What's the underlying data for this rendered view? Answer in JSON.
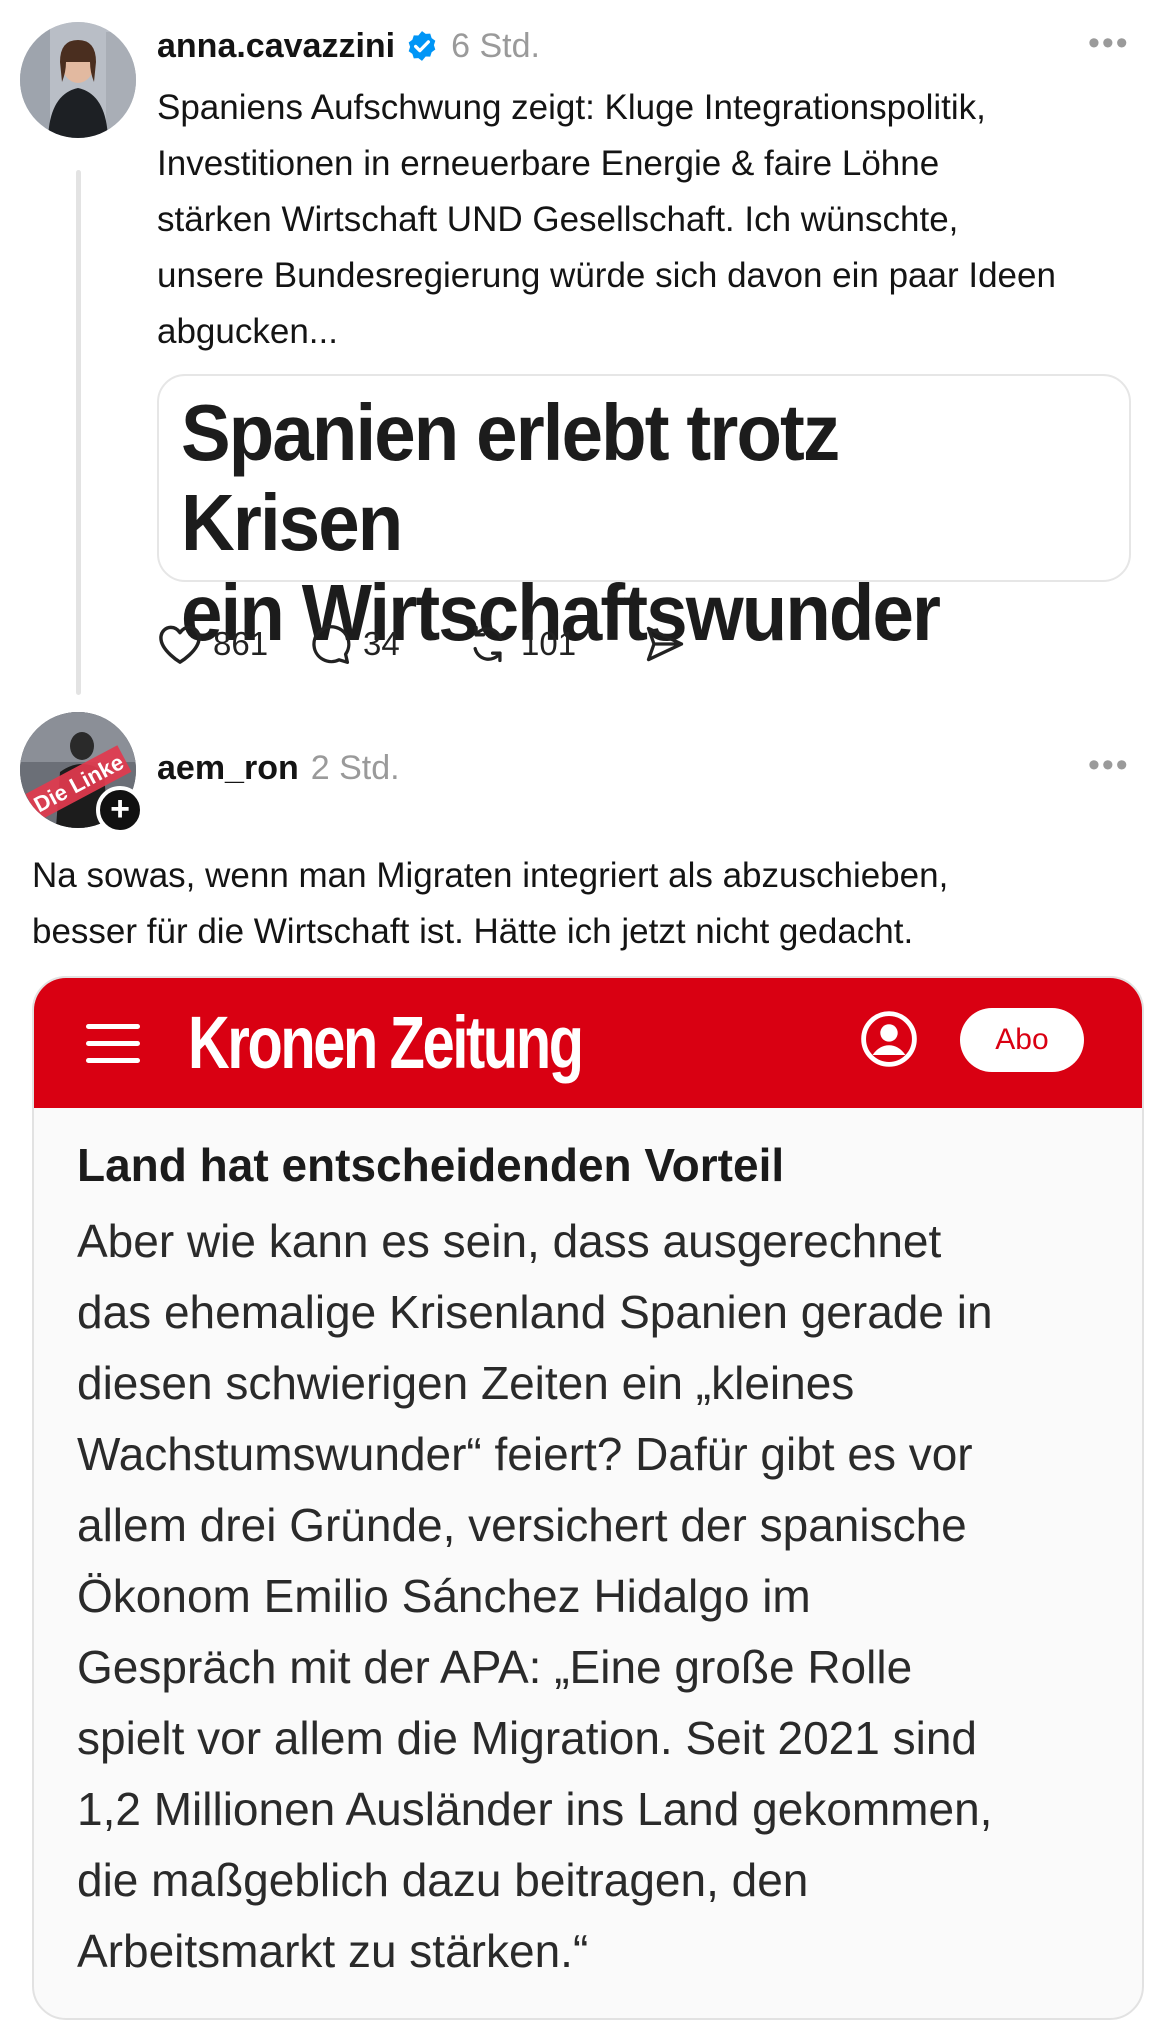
{
  "post1": {
    "username": "anna.cavazzini",
    "time": "6 Std.",
    "more": "•••",
    "text_lines": [
      "Spaniens Aufschwung zeigt: Kluge Integrationspolitik,",
      "Investitionen in erneuerbare Energie & faire Löhne",
      "stärken Wirtschaft UND Gesellschaft. Ich wünschte,",
      "unsere Bundesregierung würde sich davon ein paar Ideen",
      "abgucken..."
    ],
    "quote_lines": [
      "Spanien erlebt trotz Krisen",
      "ein Wirtschaftswunder"
    ],
    "actions": {
      "likes": "861",
      "comments": "34",
      "reposts": "101"
    }
  },
  "post2": {
    "username": "aem_ron",
    "time": "2 Std.",
    "more": "•••",
    "avatar_text": "Die Linke",
    "text_lines": [
      "Na sowas, wenn man Migraten integriert als abzuschieben,",
      "besser für die Wirtschaft ist. Hätte ich jetzt nicht gedacht."
    ]
  },
  "kronen": {
    "logo": "Kronen Zeitung",
    "abo": "Abo",
    "subheading": "Land hat entscheidenden Vorteil",
    "body_lines": [
      "Aber wie kann es sein, dass ausgerechnet",
      "das ehemalige Krisenland Spanien gerade in",
      "diesen schwierigen Zeiten ein „kleines",
      "Wachstumswunder“ feiert? Dafür gibt es vor",
      "allem drei Gründe, versichert der spanische",
      "Ökonom Emilio Sánchez Hidalgo im",
      "Gespräch mit der APA: „Eine große Rolle",
      "spielt vor allem die Migration. Seit 2021 sind",
      "1,2 Millionen Ausländer ins Land gekommen,",
      "die maßgeblich dazu beitragen, den",
      "Arbeitsmarkt zu stärken.“"
    ]
  },
  "colors": {
    "verified": "#0095f6",
    "kronen_red": "#d90012",
    "muted": "#9a9a9a"
  }
}
